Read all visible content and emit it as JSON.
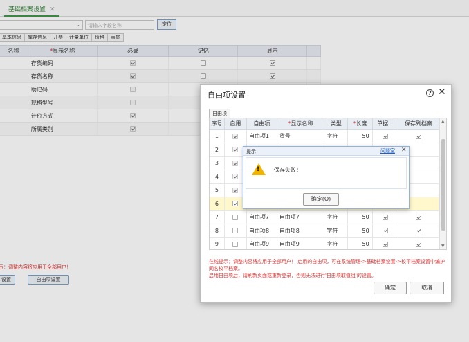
{
  "tabbar": {
    "active_tab": "基础档案设置",
    "close_glyph": "✕"
  },
  "background": {
    "search_placeholder": "请输入字段名称",
    "locate_button": "定位",
    "subtabs": [
      "基本信息",
      "库存信息",
      "开票",
      "计量单位",
      "价格",
      "表尾"
    ],
    "grid": {
      "headers": [
        "名称",
        "显示名称",
        "必录",
        "记忆",
        "显示"
      ],
      "required_marker": "*",
      "rows": [
        {
          "name": "存货编码",
          "required": true,
          "memory": false,
          "show": true
        },
        {
          "name": "存货名称",
          "required": true,
          "memory": false,
          "show": true
        },
        {
          "name": "助记码",
          "required": false,
          "memory": false,
          "show": true
        },
        {
          "name": "规格型号",
          "required": false,
          "memory": false,
          "show": true
        },
        {
          "name": "计价方式",
          "required": true,
          "memory": false,
          "show": true
        },
        {
          "name": "所属类别",
          "required": true,
          "memory": false,
          "show": true
        }
      ]
    },
    "tip": "示：调整内容将应用于全部用户！",
    "buttons": {
      "left": "设置",
      "free_item": "自由项设置"
    }
  },
  "dialog": {
    "title": "自由项设置",
    "help_glyph": "?",
    "close_glyph": "✕",
    "tab": "自由项",
    "headers": [
      "序号",
      "启用",
      "自由项",
      "显示名称",
      "类型",
      "长度",
      "单据...",
      "保存到档案"
    ],
    "required_marker": "*",
    "rows": [
      {
        "no": "1",
        "enabled": true,
        "item": "自由项1",
        "display": "货号",
        "type": "字符",
        "length": "50",
        "doc": true,
        "save": true
      },
      {
        "no": "2",
        "enabled": true,
        "item": "",
        "display": "",
        "type": "",
        "length": "",
        "doc": false,
        "save": false
      },
      {
        "no": "3",
        "enabled": true,
        "item": "",
        "display": "",
        "type": "",
        "length": "",
        "doc": false,
        "save": false
      },
      {
        "no": "4",
        "enabled": true,
        "item": "",
        "display": "",
        "type": "",
        "length": "",
        "doc": false,
        "save": false
      },
      {
        "no": "5",
        "enabled": true,
        "item": "",
        "display": "",
        "type": "",
        "length": "",
        "doc": false,
        "save": false
      },
      {
        "no": "6",
        "enabled": true,
        "item": "",
        "display": "",
        "type": "",
        "length": "",
        "doc": false,
        "save": false
      },
      {
        "no": "7",
        "enabled": false,
        "item": "自由项7",
        "display": "自由项7",
        "type": "字符",
        "length": "50",
        "doc": true,
        "save": true
      },
      {
        "no": "8",
        "enabled": false,
        "item": "自由项8",
        "display": "自由项8",
        "type": "字符",
        "length": "50",
        "doc": true,
        "save": true
      },
      {
        "no": "9",
        "enabled": false,
        "item": "自由项9",
        "display": "自由项9",
        "type": "字符",
        "length": "50",
        "doc": true,
        "save": true
      }
    ],
    "tip_line1": "在线提示：调整内容将应用于全部用户！ 启用的自由项，可在系统管理->基础档案设置->校平档案设置中编护同名校平档案。",
    "tip_line2": "启用自由项后，请刷新页面或重新登录，否则无法进行'自由项取值组'的设置。",
    "ok": "确定",
    "cancel": "取消"
  },
  "alert": {
    "title": "提示",
    "help_link": "问题室",
    "close_glyph": "✕",
    "icon": "warning-icon",
    "message": "保存失败！",
    "ok": "确定(O)"
  }
}
